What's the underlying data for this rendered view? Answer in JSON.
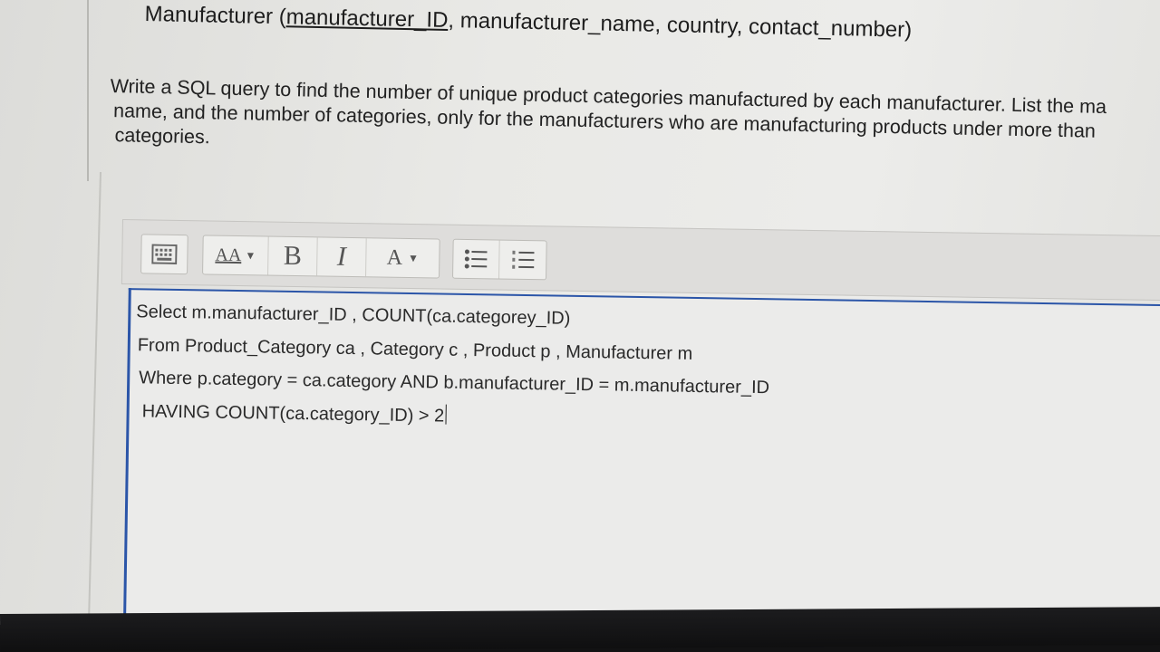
{
  "schema": {
    "prefix": "Manufacturer (",
    "key": "manufacturer_ID",
    "rest": ", manufacturer_name, country, contact_number)"
  },
  "question": {
    "lines": [
      "Write a SQL query to find the number of unique product categories manufactured by each manufacturer. List the ma",
      "name, and the number of categories, only for the manufacturers who are manufacturing products under more than",
      "categories."
    ]
  },
  "toolbar": {
    "keyboard_icon": "keyboard-icon",
    "font_size_label": "AA",
    "bold_label": "B",
    "italic_label": "I",
    "font_color_label": "A",
    "bullet_list_icon": "bullet-list-icon",
    "numbered_list_icon": "numbered-list-icon"
  },
  "editor": {
    "lines": [
      "Select m.manufacturer_ID , COUNT(ca.categorey_ID)",
      "From Product_Category ca , Category c , Product p , Manufacturer m",
      "Where p.category = ca.category AND b.manufacturer_ID = m.manufacturer_ID",
      "HAVING COUNT(ca.category_ID) > 2"
    ]
  },
  "colors": {
    "focus_border": "#2b55a8",
    "text": "#222222"
  }
}
